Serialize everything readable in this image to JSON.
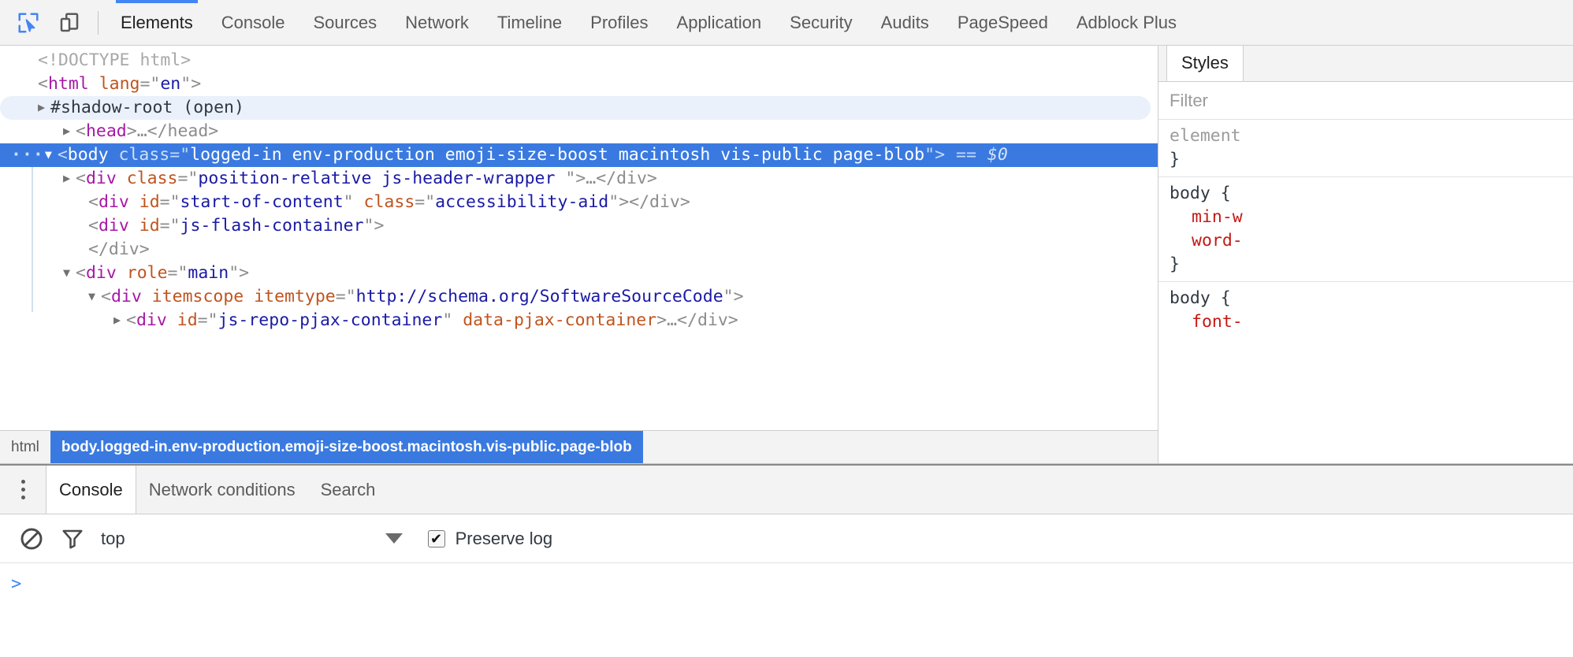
{
  "toolbar": {
    "inspect_icon": "inspect-cursor-icon",
    "device_icon": "device-toolbar-icon",
    "tabs": [
      {
        "label": "Elements",
        "active": true
      },
      {
        "label": "Console",
        "active": false
      },
      {
        "label": "Sources",
        "active": false
      },
      {
        "label": "Network",
        "active": false
      },
      {
        "label": "Timeline",
        "active": false
      },
      {
        "label": "Profiles",
        "active": false
      },
      {
        "label": "Application",
        "active": false
      },
      {
        "label": "Security",
        "active": false
      },
      {
        "label": "Audits",
        "active": false
      },
      {
        "label": "PageSpeed",
        "active": false
      },
      {
        "label": "Adblock Plus",
        "active": false
      }
    ]
  },
  "dom_tree": {
    "rows": {
      "doctype": "<!DOCTYPE html>",
      "html_open_lt": "<",
      "html_tag": "html",
      "html_attr": "lang",
      "html_eq": "=\"",
      "html_val": "en",
      "html_close": "\">",
      "shadow_root": "#shadow-root (open)",
      "head_lt": "<",
      "head_tag": "head",
      "head_gt": ">",
      "head_ellipsis": "…",
      "head_close": "</head>",
      "body_dots": "···",
      "body_lt": "<",
      "body_tag": "body",
      "body_attr": "class",
      "body_eq": "=\"",
      "body_val": "logged-in env-production emoji-size-boost macintosh vis-public page-blob",
      "body_close": "\">",
      "body_eqeq": "==",
      "body_dollar": "$0",
      "div1_lt": "<",
      "div1_tag": "div",
      "div1_attr": "class",
      "div1_val": "position-relative js-header-wrapper ",
      "div1_tail": "…</div>",
      "div2_attr1": "id",
      "div2_val1": "start-of-content",
      "div2_attr2": "class",
      "div2_val2": "accessibility-aid",
      "div2_tail": "></div>",
      "div3_attr": "id",
      "div3_val": "js-flash-container",
      "div3_gt": ">",
      "div3_close": "</div>",
      "div4_attr": "role",
      "div4_val": "main",
      "div4_gt": ">",
      "div5_attr1": "itemscope",
      "div5_attr2": "itemtype",
      "div5_val2": "http://schema.org/SoftwareSourceCode",
      "div5_gt": ">",
      "div6_attr1": "id",
      "div6_val1": "js-repo-pjax-container",
      "div6_attr2": "data-pjax-container",
      "div6_tail": ">…</div>"
    }
  },
  "breadcrumb": {
    "items": [
      {
        "label": "html",
        "active": false
      },
      {
        "label": "body.logged-in.env-production.emoji-size-boost.macintosh.vis-public.page-blob",
        "active": true
      }
    ]
  },
  "styles": {
    "tab_label": "Styles",
    "filter_placeholder": "Filter",
    "rules": [
      {
        "selector": "element",
        "brace_close": "}",
        "props": []
      },
      {
        "selector": "body {",
        "brace_close": "}",
        "props": [
          "min-w",
          "word-"
        ]
      },
      {
        "selector": "body {",
        "brace_close": "",
        "props": [
          "font-"
        ]
      }
    ]
  },
  "drawer": {
    "kebab_icon": "more-options-icon",
    "tabs": [
      {
        "label": "Console",
        "active": true
      },
      {
        "label": "Network conditions",
        "active": false
      },
      {
        "label": "Search",
        "active": false
      }
    ],
    "console_toolbar": {
      "clear_icon": "clear-console-icon",
      "filter_icon": "filter-funnel-icon",
      "context_value": "top",
      "dropdown_icon": "chevron-down-icon",
      "preserve_log_checked": "✔",
      "preserve_log_label": "Preserve log"
    },
    "prompt_symbol": ">"
  },
  "colors": {
    "accent_blue": "#3a7ae0",
    "tab_underline": "#4285f4",
    "tag_magenta": "#a718a7",
    "attr_orange": "#c0541e",
    "value_blue": "#1a1aa6",
    "prop_red": "#c41a16",
    "toolbar_bg": "#f3f3f3",
    "shadow_row_bg": "#eaf1fb"
  }
}
